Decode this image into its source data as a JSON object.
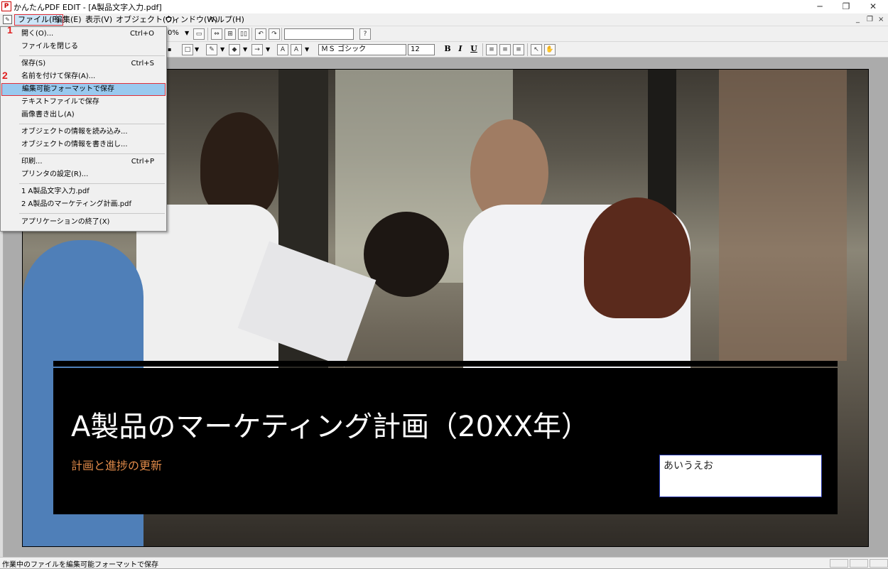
{
  "window": {
    "title": "かんたんPDF EDIT - [A製品文字入力.pdf]",
    "app_icon_glyph": "P",
    "min_glyph": "─",
    "max_glyph": "❐",
    "close_glyph": "✕"
  },
  "menubar": {
    "items": [
      "ファイル(F)",
      "編集(E)",
      "表示(V)",
      "オブジェクト(O)",
      "ウィンドウ(W)",
      "ヘルプ(H)"
    ],
    "mdi_min": "_",
    "mdi_restore": "❐",
    "mdi_close": "×"
  },
  "toolbar1": {
    "zoom_value": "0%",
    "search_value": "",
    "help_glyph": "?"
  },
  "toolbar2": {
    "font_name": "ＭＳ ゴシック",
    "font_size": "12",
    "bold": "B",
    "italic": "I",
    "underline": "U"
  },
  "file_menu": {
    "items": [
      {
        "label": "開く(O)...",
        "shortcut": "Ctrl+O"
      },
      {
        "label": "ファイルを閉じる",
        "shortcut": ""
      },
      {
        "label": "保存(S)",
        "shortcut": "Ctrl+S"
      },
      {
        "label": "名前を付けて保存(A)...",
        "shortcut": ""
      },
      {
        "label": "編集可能フォーマットで保存",
        "shortcut": ""
      },
      {
        "label": "テキストファイルで保存",
        "shortcut": ""
      },
      {
        "label": "画像書き出し(A)",
        "shortcut": ""
      },
      {
        "label": "オブジェクトの情報を読み込み...",
        "shortcut": ""
      },
      {
        "label": "オブジェクトの情報を書き出し...",
        "shortcut": ""
      },
      {
        "label": "印刷...",
        "shortcut": "Ctrl+P"
      },
      {
        "label": "プリンタの設定(R)...",
        "shortcut": ""
      },
      {
        "label": "1 A製品文字入力.pdf",
        "shortcut": ""
      },
      {
        "label": "2 A製品のマーケティング計画.pdf",
        "shortcut": ""
      },
      {
        "label": "アプリケーションの終了(X)",
        "shortcut": ""
      }
    ],
    "highlighted_index": 4
  },
  "steps": [
    "1",
    "2"
  ],
  "document": {
    "headline": "A製品のマーケティング計画（20XX年）",
    "subtitle": "計画と進捗の更新",
    "textbox": "あいうえお"
  },
  "colors": {
    "accent_orange": "#e08a49",
    "highlight": "#99c9ef",
    "step_red": "#e02020"
  },
  "statusbar": {
    "text": "作業中のファイルを編集可能フォーマットで保存"
  }
}
